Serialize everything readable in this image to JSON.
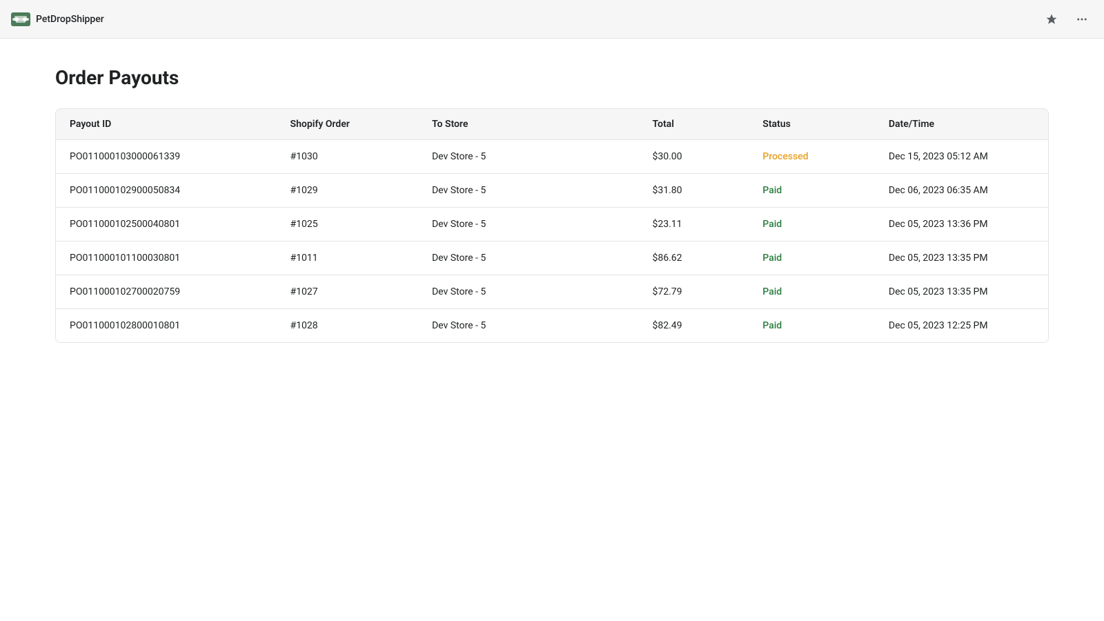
{
  "app": {
    "name": "PetDropShipper"
  },
  "header": {
    "pin_icon": "📌",
    "more_icon": "⋯"
  },
  "page": {
    "title": "Order Payouts"
  },
  "table": {
    "columns": [
      {
        "key": "payout_id",
        "label": "Payout ID"
      },
      {
        "key": "shopify_order",
        "label": "Shopify Order"
      },
      {
        "key": "to_store",
        "label": "To Store"
      },
      {
        "key": "total",
        "label": "Total"
      },
      {
        "key": "status",
        "label": "Status"
      },
      {
        "key": "datetime",
        "label": "Date/Time"
      }
    ],
    "rows": [
      {
        "payout_id": "PO011000103000061339",
        "shopify_order": "#1030",
        "to_store": "Dev Store - 5",
        "total": "$30.00",
        "status": "Processed",
        "status_type": "processed",
        "datetime": "Dec 15, 2023 05:12 AM"
      },
      {
        "payout_id": "PO011000102900050834",
        "shopify_order": "#1029",
        "to_store": "Dev Store - 5",
        "total": "$31.80",
        "status": "Paid",
        "status_type": "paid",
        "datetime": "Dec 06, 2023 06:35 AM"
      },
      {
        "payout_id": "PO011000102500040801",
        "shopify_order": "#1025",
        "to_store": "Dev Store - 5",
        "total": "$23.11",
        "status": "Paid",
        "status_type": "paid",
        "datetime": "Dec 05, 2023 13:36 PM"
      },
      {
        "payout_id": "PO011000101100030801",
        "shopify_order": "#1011",
        "to_store": "Dev Store - 5",
        "total": "$86.62",
        "status": "Paid",
        "status_type": "paid",
        "datetime": "Dec 05, 2023 13:35 PM"
      },
      {
        "payout_id": "PO011000102700020759",
        "shopify_order": "#1027",
        "to_store": "Dev Store - 5",
        "total": "$72.79",
        "status": "Paid",
        "status_type": "paid",
        "datetime": "Dec 05, 2023 13:35 PM"
      },
      {
        "payout_id": "PO011000102800010801",
        "shopify_order": "#1028",
        "to_store": "Dev Store - 5",
        "total": "$82.49",
        "status": "Paid",
        "status_type": "paid",
        "datetime": "Dec 05, 2023 12:25 PM"
      }
    ]
  }
}
